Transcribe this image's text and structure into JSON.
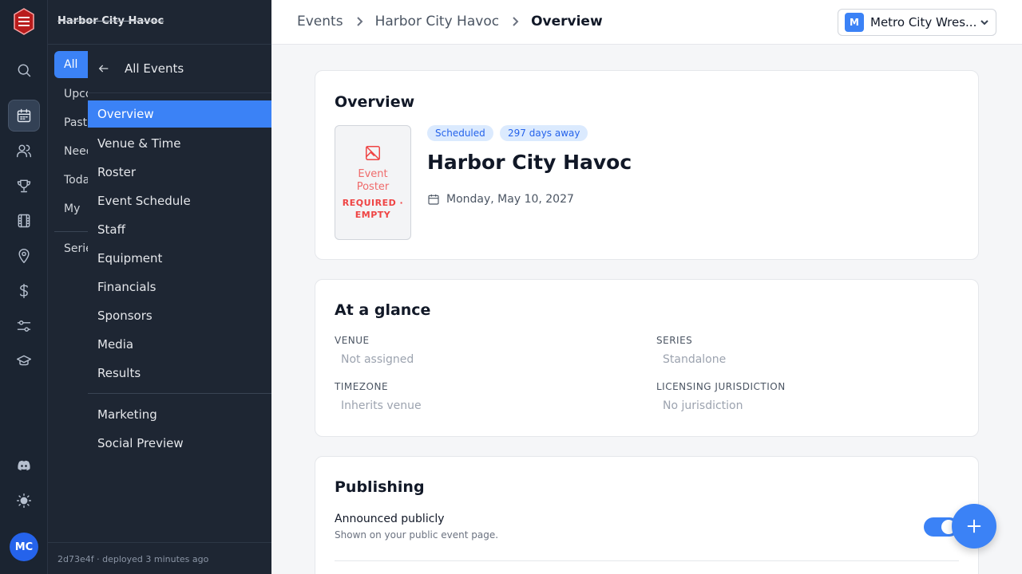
{
  "sidebar": {
    "brand": "Harbor City Havoc",
    "under_items": [
      "All",
      "Upcoming",
      "Past",
      "Needs",
      "Today",
      "My"
    ],
    "under_series": "Series",
    "back_label": "All Events",
    "event_nav": [
      "Overview",
      "Venue & Time",
      "Roster",
      "Event Schedule",
      "Staff",
      "Equipment",
      "Financials",
      "Sponsors",
      "Media",
      "Results"
    ],
    "event_nav_2": [
      "Marketing",
      "Social Preview"
    ],
    "build_info": "2d73e4f  · deployed 3 minutes ago"
  },
  "rail": {
    "icons": [
      "search-icon",
      "calendar-icon",
      "users-icon",
      "trophy-icon",
      "film-icon",
      "map-pin-icon",
      "dollar-icon",
      "sliders-icon",
      "graduation-cap-icon",
      "discord-icon",
      "sun-icon"
    ],
    "avatar_initials": "MC"
  },
  "header": {
    "breadcrumb": [
      "Events",
      "Harbor City Havoc",
      "Overview"
    ],
    "org_initial": "M",
    "org_name": "Metro City Wres..."
  },
  "overview": {
    "title": "Overview",
    "poster_label": "Event Poster",
    "poster_status": "REQUIRED · EMPTY",
    "status_pill": "Scheduled",
    "countdown_pill": "297 days away",
    "event_name": "Harbor City Havoc",
    "event_date": "Monday, May 10, 2027"
  },
  "glance": {
    "title": "At a glance",
    "venue_label": "VENUE",
    "venue_value": "Not assigned",
    "series_label": "SERIES",
    "series_value": "Standalone",
    "timezone_label": "TIMEZONE",
    "timezone_value": "Inherits venue",
    "jurisdiction_label": "LICENSING JURISDICTION",
    "jurisdiction_value": "No jurisdiction"
  },
  "publishing": {
    "title": "Publishing",
    "announced_label": "Announced publicly",
    "announced_sub": "Shown on your public event page.",
    "announced_on": true
  },
  "colors": {
    "accent": "#3b82f6",
    "rail_bg": "#1b2431",
    "sidebar_bg": "#1e2633"
  }
}
